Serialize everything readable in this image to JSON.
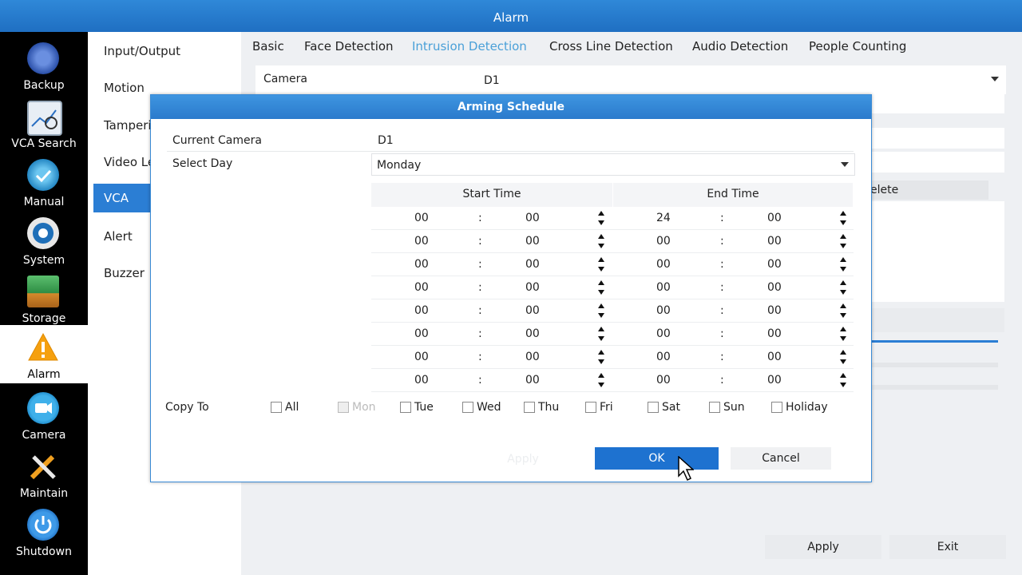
{
  "window": {
    "title": "Alarm"
  },
  "nav": [
    {
      "label": "Backup",
      "icon": "backup-icon"
    },
    {
      "label": "VCA Search",
      "icon": "vca-search-icon"
    },
    {
      "label": "Manual",
      "icon": "manual-icon"
    },
    {
      "label": "System",
      "icon": "system-gear-icon"
    },
    {
      "label": "Storage",
      "icon": "storage-icon"
    },
    {
      "label": "Alarm",
      "icon": "alarm-warning-icon"
    },
    {
      "label": "Camera",
      "icon": "camera-icon"
    },
    {
      "label": "Maintain",
      "icon": "maintain-tools-icon"
    },
    {
      "label": "Shutdown",
      "icon": "shutdown-icon"
    }
  ],
  "submenu": [
    "Input/Output",
    "Motion",
    "Tamperi",
    "Video Le",
    "VCA",
    "Alert",
    "Buzzer"
  ],
  "tabs": [
    "Basic",
    "Face Detection",
    "Intrusion Detection",
    "Cross Line Detection",
    "Audio Detection",
    "People Counting"
  ],
  "background": {
    "camera_label": "Camera",
    "camera_value": "D1",
    "partial_delete": "elete",
    "apply": "Apply",
    "exit": "Exit"
  },
  "dialog": {
    "title": "Arming Schedule",
    "current_camera_label": "Current Camera",
    "current_camera_value": "D1",
    "select_day_label": "Select Day",
    "select_day_value": "Monday",
    "start_time_header": "Start Time",
    "end_time_header": "End Time",
    "separator": ":",
    "rows": [
      {
        "sh": "00",
        "sm": "00",
        "eh": "24",
        "em": "00"
      },
      {
        "sh": "00",
        "sm": "00",
        "eh": "00",
        "em": "00"
      },
      {
        "sh": "00",
        "sm": "00",
        "eh": "00",
        "em": "00"
      },
      {
        "sh": "00",
        "sm": "00",
        "eh": "00",
        "em": "00"
      },
      {
        "sh": "00",
        "sm": "00",
        "eh": "00",
        "em": "00"
      },
      {
        "sh": "00",
        "sm": "00",
        "eh": "00",
        "em": "00"
      },
      {
        "sh": "00",
        "sm": "00",
        "eh": "00",
        "em": "00"
      },
      {
        "sh": "00",
        "sm": "00",
        "eh": "00",
        "em": "00"
      }
    ],
    "copy_to_label": "Copy To",
    "copy_days": [
      {
        "label": "All",
        "disabled": false
      },
      {
        "label": "Mon",
        "disabled": true
      },
      {
        "label": "Tue",
        "disabled": false
      },
      {
        "label": "Wed",
        "disabled": false
      },
      {
        "label": "Thu",
        "disabled": false
      },
      {
        "label": "Fri",
        "disabled": false
      },
      {
        "label": "Sat",
        "disabled": false
      },
      {
        "label": "Sun",
        "disabled": false
      },
      {
        "label": "Holiday",
        "disabled": false
      }
    ],
    "apply": "Apply",
    "ok": "OK",
    "cancel": "Cancel"
  },
  "colors": {
    "accent": "#2b7ed4",
    "title_bar": "#2a7acc",
    "sidebar": "#000000"
  }
}
